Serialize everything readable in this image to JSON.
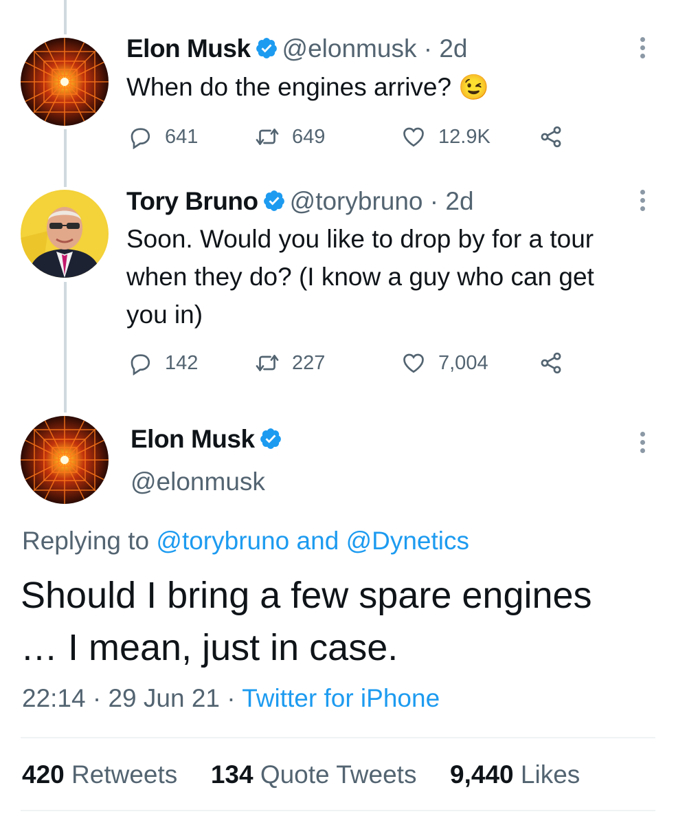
{
  "tweets": [
    {
      "author": "Elon Musk",
      "handle": "@elonmusk",
      "age": "2d",
      "text": "When do the engines arrive?",
      "emoji": "😉",
      "replies": "641",
      "retweets": "649",
      "likes": "12.9K"
    },
    {
      "author": "Tory Bruno",
      "handle": "@torybruno",
      "age": "2d",
      "text_lines": [
        "Soon. Would you like to drop by for a tour",
        "when they do? (I know a guy who can get",
        "you in)"
      ],
      "replies": "142",
      "retweets": "227",
      "likes": "7,004"
    }
  ],
  "main_tweet": {
    "author": "Elon Musk",
    "handle": "@elonmusk",
    "replying_prefix": "Replying to",
    "replying_user1": "@torybruno",
    "replying_and": "and",
    "replying_user2": "@Dynetics",
    "text_lines": [
      "Should I bring a few spare engines",
      "… I mean, just in case."
    ],
    "time": "22:14",
    "date": "29 Jun 21",
    "source": "Twitter for iPhone",
    "retweets_count": "420",
    "retweets_label": "Retweets",
    "quotes_count": "134",
    "quotes_label": "Quote Tweets",
    "likes_count": "9,440",
    "likes_label": "Likes"
  },
  "colors": {
    "accent": "#1d9bf0",
    "muted": "#536471",
    "text": "#0f1419",
    "thread": "#cfd9de"
  },
  "icons": [
    "reply-icon",
    "retweet-icon",
    "like-icon",
    "share-icon",
    "verified-badge-icon",
    "more-icon"
  ]
}
